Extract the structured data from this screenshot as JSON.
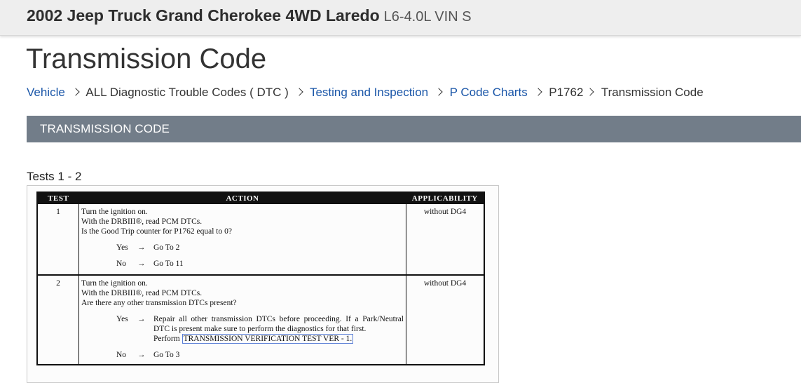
{
  "header": {
    "vehicle": "2002 Jeep Truck Grand Cherokee 4WD Laredo",
    "engine": "L6-4.0L VIN S"
  },
  "page_title": "Transmission Code",
  "breadcrumb": [
    {
      "label": "Vehicle",
      "link": true
    },
    {
      "label": "ALL Diagnostic Trouble Codes ( DTC )",
      "link": false
    },
    {
      "label": "Testing and Inspection",
      "link": true
    },
    {
      "label": "P Code Charts",
      "link": true
    },
    {
      "label": "P1762",
      "link": false
    },
    {
      "label": "Transmission Code",
      "link": false
    }
  ],
  "section_title": "TRANSMISSION CODE",
  "tests_label": "Tests 1 - 2",
  "table": {
    "headers": [
      "TEST",
      "ACTION",
      "APPLICABILITY"
    ],
    "rows": [
      {
        "test": "1",
        "lines": [
          "Turn the ignition on.",
          "With the DRBIII®, read PCM DTCs.",
          "Is the Good Trip counter for P1762 equal to 0?"
        ],
        "yes": {
          "label": "Yes",
          "arrow": "→",
          "result": "Go To  2"
        },
        "no": {
          "label": "No",
          "arrow": "→",
          "result": "Go To  11"
        },
        "applicability": "without DG4"
      },
      {
        "test": "2",
        "lines": [
          "Turn the ignition on.",
          "With the DRBIII®, read PCM DTCs.",
          "Are there any other transmission DTCs present?"
        ],
        "yes": {
          "label": "Yes",
          "arrow": "→",
          "result": "Repair all other transmission DTCs before proceeding. If a Park/Neutral DTC is present make sure to perform the diagnostics for that first.",
          "perform": "Perform",
          "link": "TRANSMISSION VERIFICATION TEST VER - 1."
        },
        "no": {
          "label": "No",
          "arrow": "→",
          "result": "Go To  3"
        },
        "applicability": "without DG4"
      }
    ]
  }
}
